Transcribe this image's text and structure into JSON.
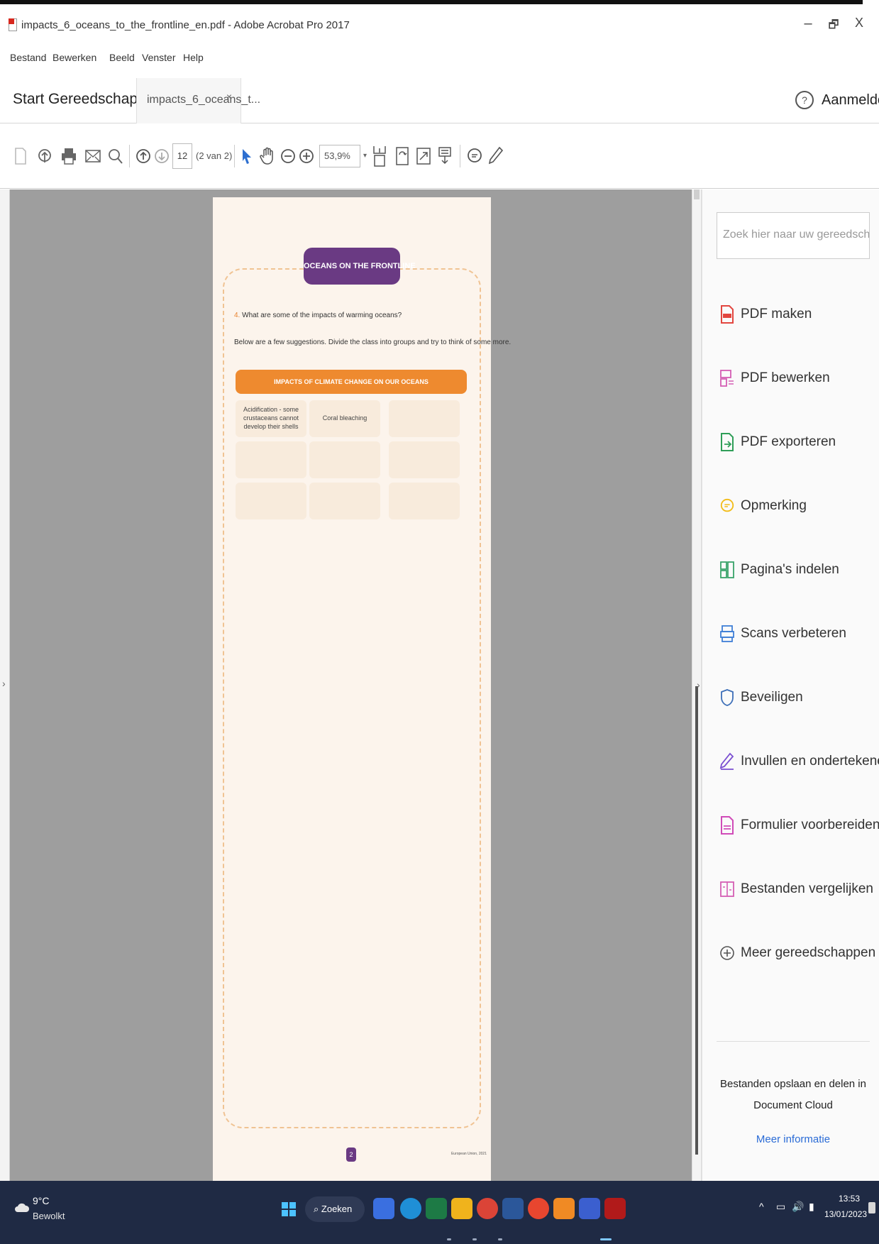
{
  "window": {
    "title": "impacts_6_oceans_to_the_frontline_en.pdf - Adobe Acrobat Pro 2017",
    "minimize": "–",
    "restore": "🗗",
    "close": "X"
  },
  "menu": [
    "Bestand",
    "Bewerken",
    "Beeld",
    "Venster",
    "Help"
  ],
  "tabs": {
    "home": "Start",
    "tools": "Gereedschappen",
    "doc": "impacts_6_oceans_t...",
    "doc_close": "×"
  },
  "header": {
    "help": "?",
    "signin": "Aanmelden"
  },
  "toolbar": {
    "page_current": "12",
    "page_count": "(2 van 2)",
    "zoom": "53,9%",
    "zoom_arrow": "▾"
  },
  "document": {
    "heading": "OCEANS ON THE FRONTLINE",
    "question_num": "4.",
    "question": "What are some of the impacts of warming oceans?",
    "intro": "Below are a few suggestions. Divide the class into groups and try to think of some more.",
    "table_header": "IMPACTS OF CLIMATE CHANGE ON OUR OCEANS",
    "cells": [
      [
        "Acidification - some crustaceans cannot develop their shells",
        "Coral bleaching",
        ""
      ],
      [
        "",
        "",
        ""
      ],
      [
        "",
        "",
        ""
      ]
    ],
    "page_number": "2",
    "footer": "European Union, 2021"
  },
  "right_pane": {
    "search_placeholder": "Zoek hier naar uw gereedschappen",
    "tools": [
      {
        "label": "PDF maken",
        "icon": "pdf-create-icon",
        "color": "#e2463f"
      },
      {
        "label": "PDF bewerken",
        "icon": "pdf-edit-icon",
        "color": "#d45fb4"
      },
      {
        "label": "PDF exporteren",
        "icon": "pdf-export-icon",
        "color": "#2f9e58"
      },
      {
        "label": "Opmerking",
        "icon": "comment-icon",
        "color": "#f2bc18"
      },
      {
        "label": "Pagina's indelen",
        "icon": "organize-pages-icon",
        "color": "#39a36a"
      },
      {
        "label": "Scans verbeteren",
        "icon": "enhance-scans-icon",
        "color": "#3f7fd6"
      },
      {
        "label": "Beveiligen",
        "icon": "protect-icon",
        "color": "#3d6fb8"
      },
      {
        "label": "Invullen en ondertekenen",
        "icon": "fill-sign-icon",
        "color": "#7a4fd1"
      },
      {
        "label": "Formulier voorbereiden",
        "icon": "prepare-form-icon",
        "color": "#d04bb8"
      },
      {
        "label": "Bestanden vergelijken",
        "icon": "compare-files-icon",
        "color": "#d45fb4"
      },
      {
        "label": "Meer gereedschappen",
        "icon": "more-tools-icon",
        "color": "#555555"
      }
    ],
    "cloud_text": "Bestanden opslaan en delen in Document Cloud",
    "cloud_link": "Meer informatie"
  },
  "taskbar": {
    "temp": "9°C",
    "condition": "Bewolkt",
    "search": "Zoeken",
    "tray": "^",
    "time": "13:53",
    "date": "13/01/2023"
  },
  "colors": {
    "heading_purple": "#6a3a83",
    "table_orange": "#ee8a2f",
    "page_bg": "#fcf4ec",
    "cell_bg": "#f8ebdc",
    "taskbar": "#1f2a44",
    "link": "#2a6bd6"
  }
}
